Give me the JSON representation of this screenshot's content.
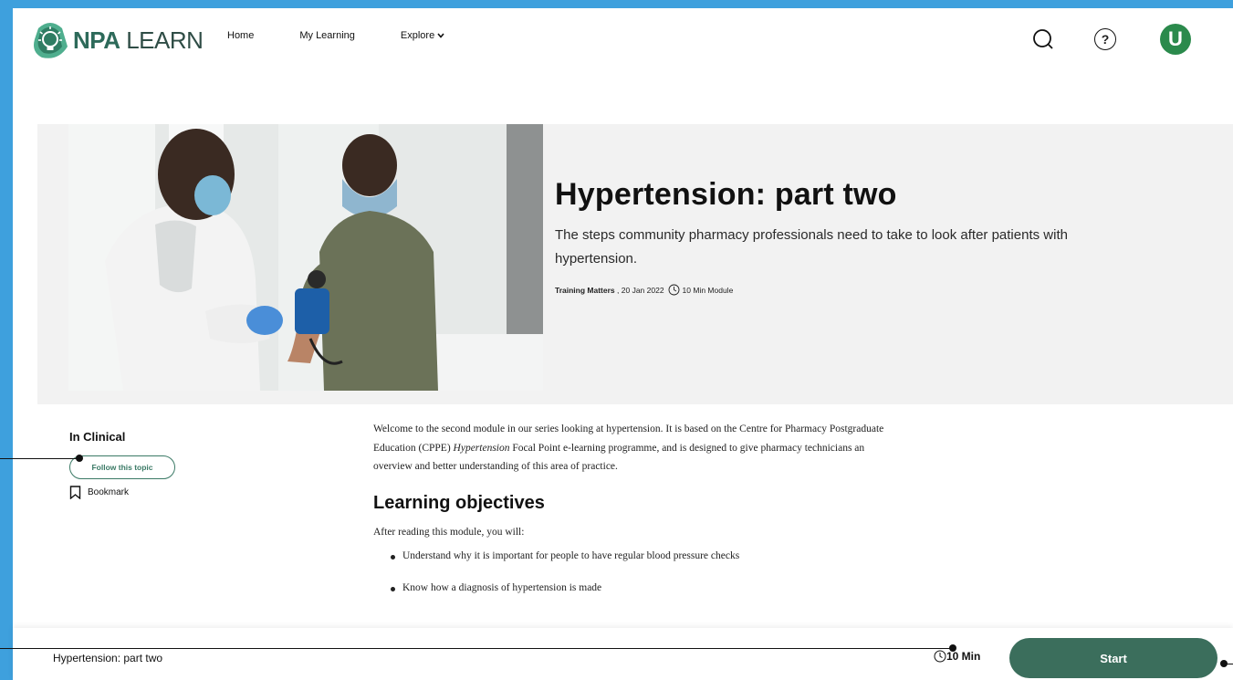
{
  "brand": {
    "name_bold": "NPA",
    "name_light": " LEARN",
    "colors": {
      "frame": "#3ea0dd",
      "primary": "#3b6e5c",
      "avatar": "#2b8a4c"
    }
  },
  "nav": {
    "items": [
      {
        "label": "Home"
      },
      {
        "label": "My Learning"
      },
      {
        "label": "Explore"
      }
    ],
    "icons": [
      "search-icon",
      "help-icon",
      "avatar"
    ],
    "help_glyph": "?",
    "avatar_initial": "U"
  },
  "hero": {
    "title": "Hypertension: part two",
    "description": "The steps community pharmacy professionals need to take to look after patients with hypertension.",
    "meta": {
      "source": "Training Matters",
      "date": ", 20 Jan 2022",
      "duration": "10 Min Module"
    }
  },
  "sidebar": {
    "category": "In Clinical",
    "follow_label": "Follow this topic",
    "bookmark_label": "Bookmark"
  },
  "content": {
    "intro_part1": "Welcome to the second module in our series looking at hypertension. It is based on the Centre for Pharmacy Postgraduate Education (CPPE) ",
    "intro_italic": "Hypertension",
    "intro_part2": " Focal Point e-learning programme, and is designed to give pharmacy technicians an overview and better understanding of this area of practice.",
    "objectives_heading": "Learning objectives",
    "objectives_lead": "After reading this module, you will:",
    "objectives": [
      "Understand why it is important for people to have regular blood pressure checks",
      "Know how a diagnosis of hypertension is made"
    ]
  },
  "bottom_bar": {
    "title": "Hypertension: part two",
    "time": "10 Min",
    "start_label": "Start"
  }
}
